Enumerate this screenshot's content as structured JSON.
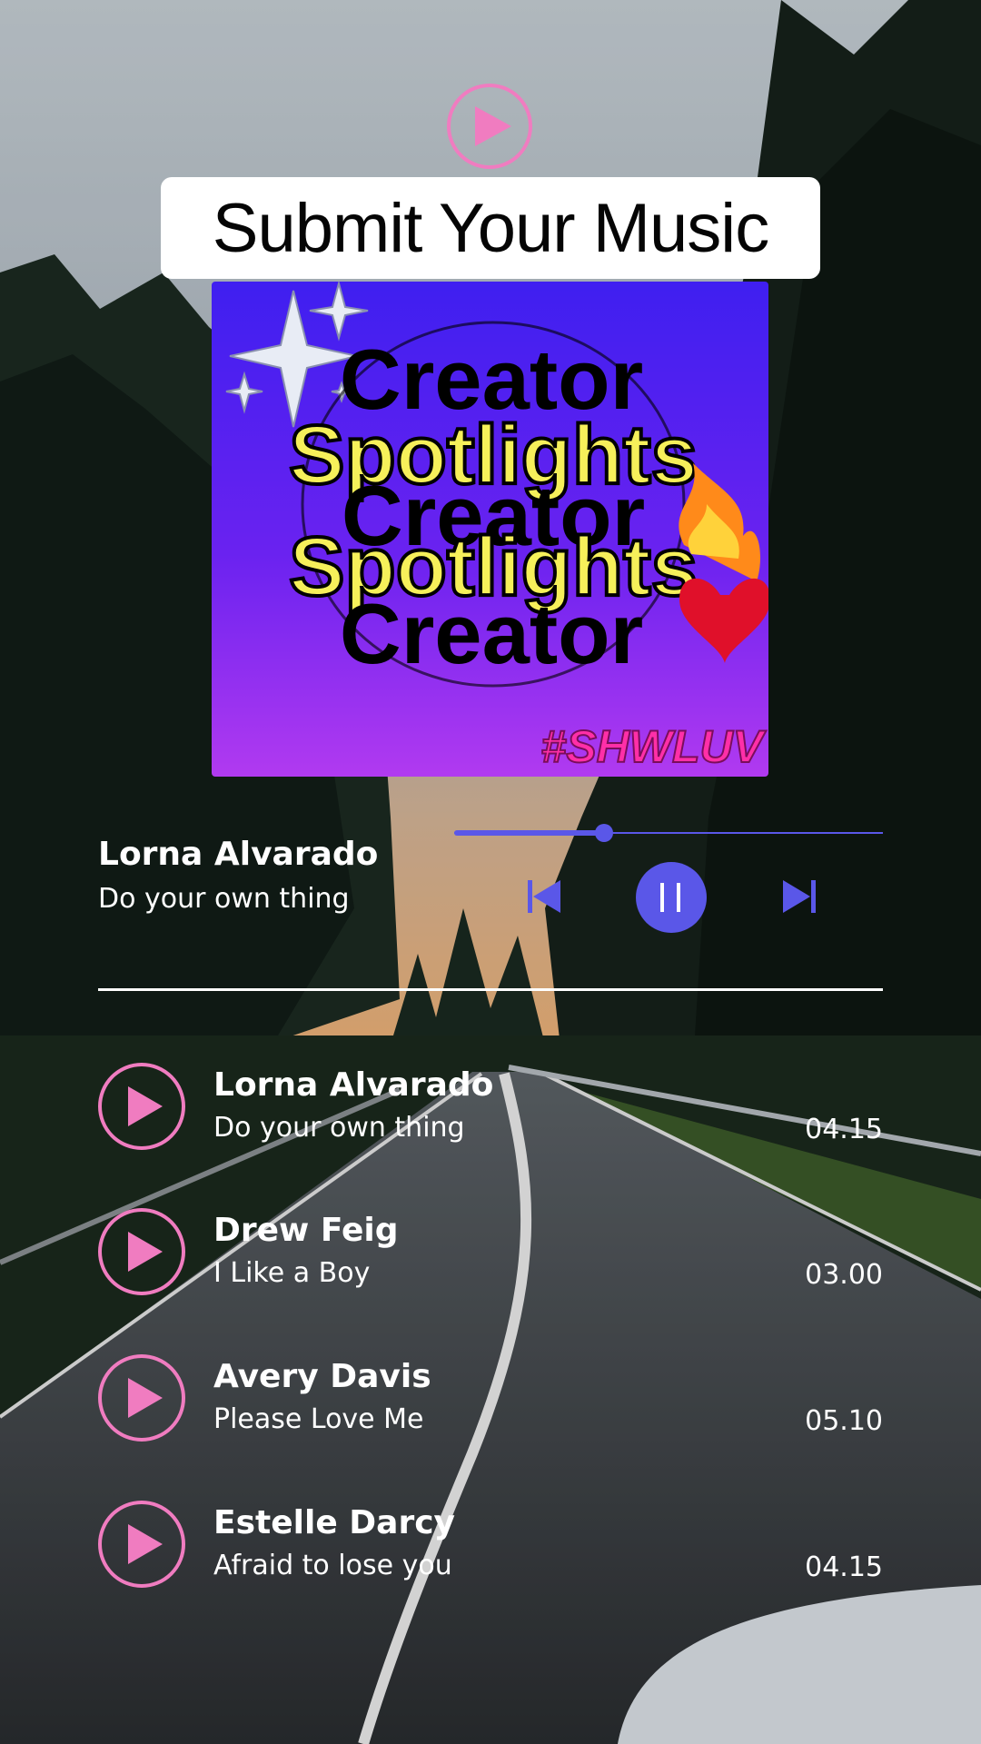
{
  "header": {
    "title": "Submit Your Music"
  },
  "cover": {
    "words": [
      "Creator",
      "Spotlights",
      "Creator",
      "Spotlights",
      "Creator"
    ],
    "tag": "#SHWLUV"
  },
  "now_playing": {
    "artist": "Lorna Alvarado",
    "song": "Do your own thing",
    "progress": 0.35
  },
  "playlist": [
    {
      "artist": "Lorna Alvarado",
      "song": "Do your own thing",
      "duration": "04.15"
    },
    {
      "artist": "Drew Feig",
      "song": "I Like a Boy",
      "duration": "03.00"
    },
    {
      "artist": "Avery Davis",
      "song": "Please Love Me",
      "duration": "05.10"
    },
    {
      "artist": "Estelle Darcy",
      "song": "Afraid to lose you",
      "duration": "04.15"
    }
  ],
  "icons": {
    "top_play": "play-icon",
    "prev": "skip-previous-icon",
    "pause": "pause-icon",
    "next": "skip-next-icon",
    "track_play": "play-icon"
  },
  "colors": {
    "accent_pink": "#f07cc0",
    "accent_purple": "#5a57e8",
    "text": "#ffffff"
  }
}
